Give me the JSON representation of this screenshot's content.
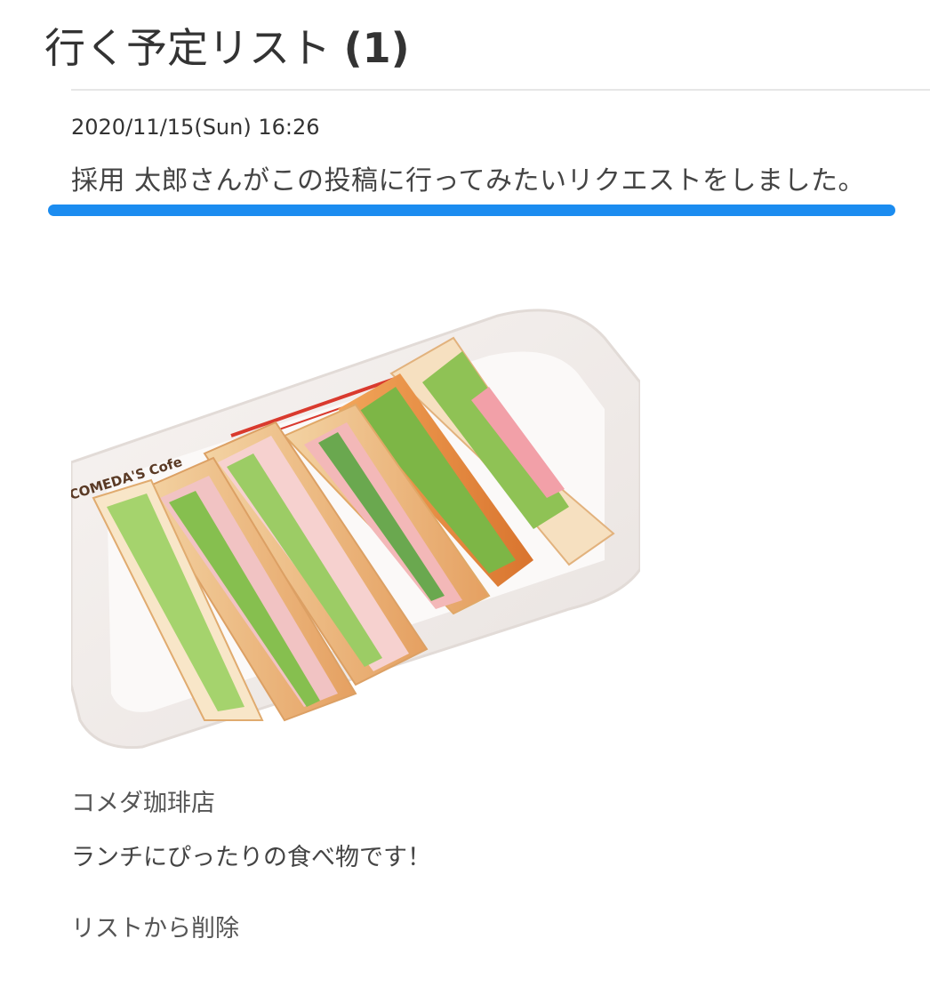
{
  "header": {
    "title": "行く予定リスト",
    "count": "(1)"
  },
  "entry": {
    "timestamp": "2020/11/15(Sun) 16:26",
    "notice": "採用 太郎さんがこの投稿に行ってみたいリクエストをしました。",
    "highlight_color": "#1b8cf0",
    "photo": {
      "icon": "sandwich-photo",
      "plate_text": "COMEDA'S Cofe"
    },
    "shop_name": "コメダ珈琲店",
    "description": "ランチにぴったりの食べ物です！",
    "remove_label": "リストから削除"
  }
}
